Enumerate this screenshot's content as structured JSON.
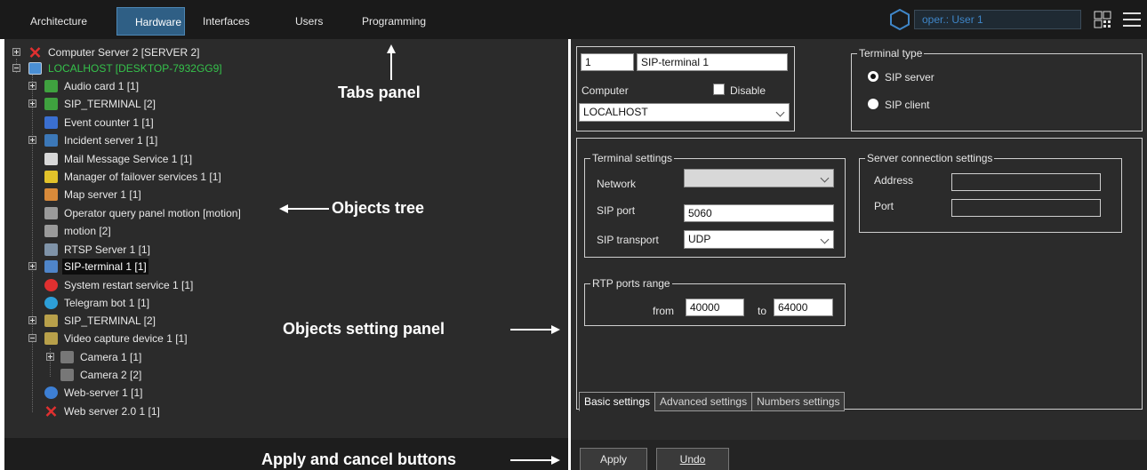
{
  "tabs": [
    {
      "label": "Architecture",
      "active": false
    },
    {
      "label": "Hardware",
      "active": true
    },
    {
      "label": "Interfaces",
      "active": false
    },
    {
      "label": "Users",
      "active": false
    },
    {
      "label": "Programming",
      "active": false
    }
  ],
  "header": {
    "user_field": "oper.: User 1",
    "icons": [
      "hexagon-logo-icon",
      "layout-grid-icon",
      "hamburger-menu-icon"
    ]
  },
  "tree": [
    {
      "label": "Computer Server 2 [SERVER 2]",
      "icon": "red-x-icon"
    },
    {
      "label": "LOCALHOST [DESKTOP-7932GG9]",
      "icon": "monitor-icon"
    },
    {
      "label": "Audio card 1 [1]",
      "icon": "audio-card-icon"
    },
    {
      "label": "SIP_TERMINAL [2]",
      "icon": "audio-card-icon"
    },
    {
      "label": "Event counter 1 [1]",
      "icon": "event-counter-icon"
    },
    {
      "label": "Incident server 1 [1]",
      "icon": "incident-server-icon"
    },
    {
      "label": "Mail Message Service 1 [1]",
      "icon": "mail-icon"
    },
    {
      "label": "Manager of failover services 1 [1]",
      "icon": "failover-icon"
    },
    {
      "label": "Map server 1 [1]",
      "icon": "map-icon"
    },
    {
      "label": "Operator query panel motion [motion]",
      "icon": "motion-icon"
    },
    {
      "label": "motion [2]",
      "icon": "motion-icon"
    },
    {
      "label": "RTSP Server 1 [1]",
      "icon": "rtsp-icon"
    },
    {
      "label": "SIP-terminal 1 [1]",
      "icon": "sip-terminal-icon"
    },
    {
      "label": "System restart service 1 [1]",
      "icon": "power-icon"
    },
    {
      "label": "Telegram bot 1 [1]",
      "icon": "telegram-icon"
    },
    {
      "label": "SIP_TERMINAL [2]",
      "icon": "sip-board-icon"
    },
    {
      "label": "Video capture device 1 [1]",
      "icon": "video-capture-icon"
    },
    {
      "label": "Camera 1 [1]",
      "icon": "camera-icon"
    },
    {
      "label": "Camera 2 [2]",
      "icon": "camera-icon"
    },
    {
      "label": "Web-server 1 [1]",
      "icon": "globe-icon"
    },
    {
      "label": "Web server 2.0 1 [1]",
      "icon": "red-x-icon"
    }
  ],
  "annotations": {
    "tabs_panel": "Tabs panel",
    "objects_tree": "Objects tree",
    "objects_setting_panel": "Objects setting panel",
    "apply_cancel": "Apply and cancel buttons"
  },
  "object": {
    "id": "1",
    "name": "SIP-terminal 1",
    "computer_label": "Computer",
    "computer_value": "LOCALHOST",
    "disable_label": "Disable"
  },
  "terminal_type": {
    "title": "Terminal type",
    "options": [
      "SIP server",
      "SIP client"
    ],
    "selected": "SIP server"
  },
  "terminal_settings": {
    "title": "Terminal settings",
    "network_label": "Network",
    "network_value": "",
    "sip_port_label": "SIP port",
    "sip_port_value": "5060",
    "sip_transport_label": "SIP transport",
    "sip_transport_value": "UDP"
  },
  "server_connection": {
    "title": "Server connection settings",
    "address_label": "Address",
    "address_value": "",
    "port_label": "Port",
    "port_value": ""
  },
  "rtp": {
    "title": "RTP ports range",
    "from_label": "from",
    "from_value": "40000",
    "to_label": "to",
    "to_value": "64000"
  },
  "bottom_tabs": [
    "Basic settings",
    "Advanced settings",
    "Numbers settings"
  ],
  "buttons": {
    "apply": "Apply",
    "undo": "Undo"
  }
}
